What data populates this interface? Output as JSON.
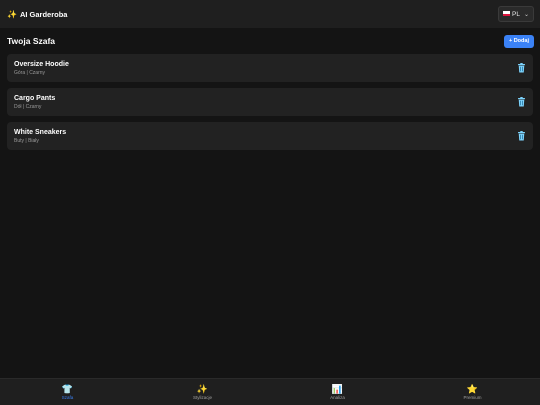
{
  "header": {
    "title": "AI Garderoba",
    "title_icon": "✨",
    "language": {
      "selected": "PL",
      "flag": "poland-flag"
    }
  },
  "section": {
    "title": "Twoja Szafa",
    "add_label": "+ Dodaj"
  },
  "items": [
    {
      "name": "Oversize Hoodie",
      "meta": "Góra | Czarny"
    },
    {
      "name": "Cargo Pants",
      "meta": "Dół | Czarny"
    },
    {
      "name": "White Sneakers",
      "meta": "Buty | Biały"
    }
  ],
  "nav": [
    {
      "icon": "👕",
      "label": "Szafa",
      "active": true
    },
    {
      "icon": "✨",
      "label": "Stylizacje",
      "active": false
    },
    {
      "icon": "📊",
      "label": "Analiza",
      "active": false
    },
    {
      "icon": "⭐",
      "label": "Premium",
      "active": false
    }
  ],
  "colors": {
    "accent": "#3b82f6",
    "background": "#141414",
    "card": "#222222",
    "trash": "#7dd3fc"
  }
}
